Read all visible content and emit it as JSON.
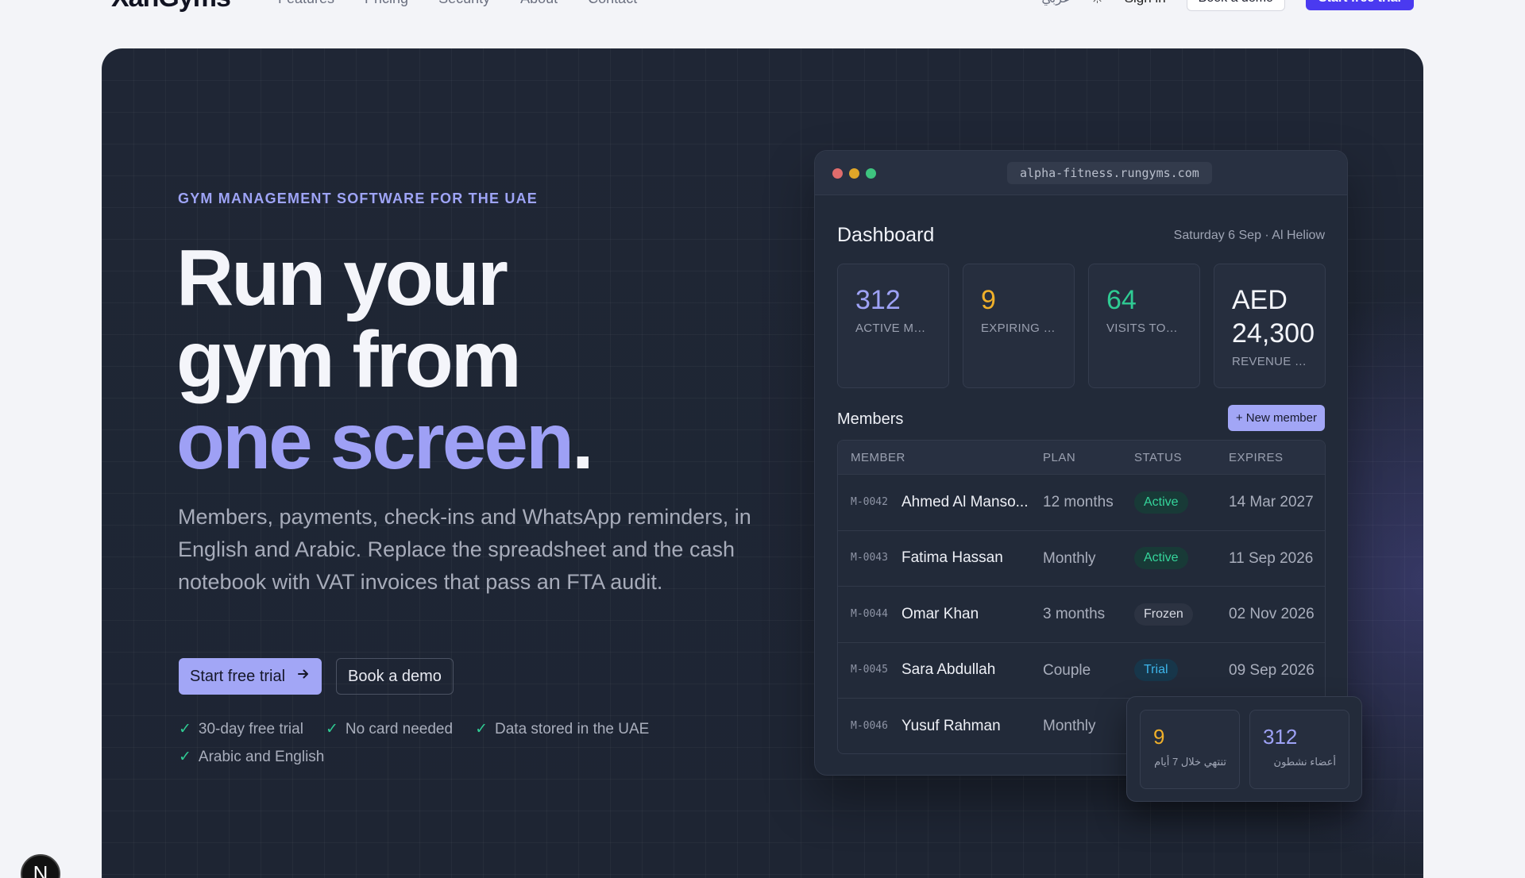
{
  "nav": {
    "brand": "XanGyms",
    "links": [
      "Features",
      "Pricing",
      "Security",
      "About",
      "Contact"
    ],
    "lang": "عربي",
    "theme_icon": "sun-icon",
    "signin": "Sign in",
    "demo": "Book a demo",
    "trial": "Start free trial"
  },
  "hero": {
    "eyebrow": "GYM MANAGEMENT SOFTWARE FOR THE UAE",
    "headline_line1": "Run your",
    "headline_line2": "gym from",
    "headline_accent": "one screen",
    "headline_period": ".",
    "subtext": "Members, payments, check-ins and WhatsApp reminders, in English and Arabic. Replace the spreadsheet and the cash notebook with VAT invoices that pass an FTA audit.",
    "cta_primary": "Start free trial",
    "cta_primary_icon": "arrow-right-icon",
    "cta_secondary": "Book a demo",
    "checks": [
      "30-day free trial",
      "No card needed",
      "Data stored in the UAE",
      "Arabic and English"
    ]
  },
  "browser": {
    "url": "alpha-fitness.rungyms.com",
    "dashboard_title": "Dashboard",
    "date": "Saturday 6 Sep · Al Heliow",
    "stats": [
      {
        "value": "312",
        "label": "ACTIVE ME..."
      },
      {
        "value": "9",
        "label": "EXPIRING I..."
      },
      {
        "value": "64",
        "label": "VISITS TOD..."
      },
      {
        "value": "AED 24,300",
        "label": "REVENUE T..."
      }
    ],
    "members_title": "Members",
    "new_member": "+ New member",
    "columns": [
      "MEMBER",
      "PLAN",
      "STATUS",
      "EXPIRES"
    ],
    "rows": [
      {
        "id": "M-0042",
        "name": "Ahmed Al Manso...",
        "plan": "12 months",
        "status": "Active",
        "expires": "14 Mar 2027"
      },
      {
        "id": "M-0043",
        "name": "Fatima Hassan",
        "plan": "Monthly",
        "status": "Active",
        "expires": "11 Sep 2026"
      },
      {
        "id": "M-0044",
        "name": "Omar Khan",
        "plan": "3 months",
        "status": "Frozen",
        "expires": "02 Nov 2026"
      },
      {
        "id": "M-0045",
        "name": "Sara Abdullah",
        "plan": "Couple",
        "status": "Trial",
        "expires": "09 Sep 2026"
      },
      {
        "id": "M-0046",
        "name": "Yusuf Rahman",
        "plan": "Monthly",
        "status": "",
        "expires": ""
      }
    ]
  },
  "float_card": {
    "stats": [
      {
        "value": "9",
        "label": "تنتهي خلال 7 أيام"
      },
      {
        "value": "312",
        "label": "أعضاء نشطون"
      }
    ]
  },
  "corner_avatar": "N",
  "colors": {
    "accent": "#9ea2f6",
    "brand_button": "#4a3af0",
    "success": "#2fcb93",
    "warning": "#f0b02a",
    "hero_bg": "#1f2635"
  }
}
